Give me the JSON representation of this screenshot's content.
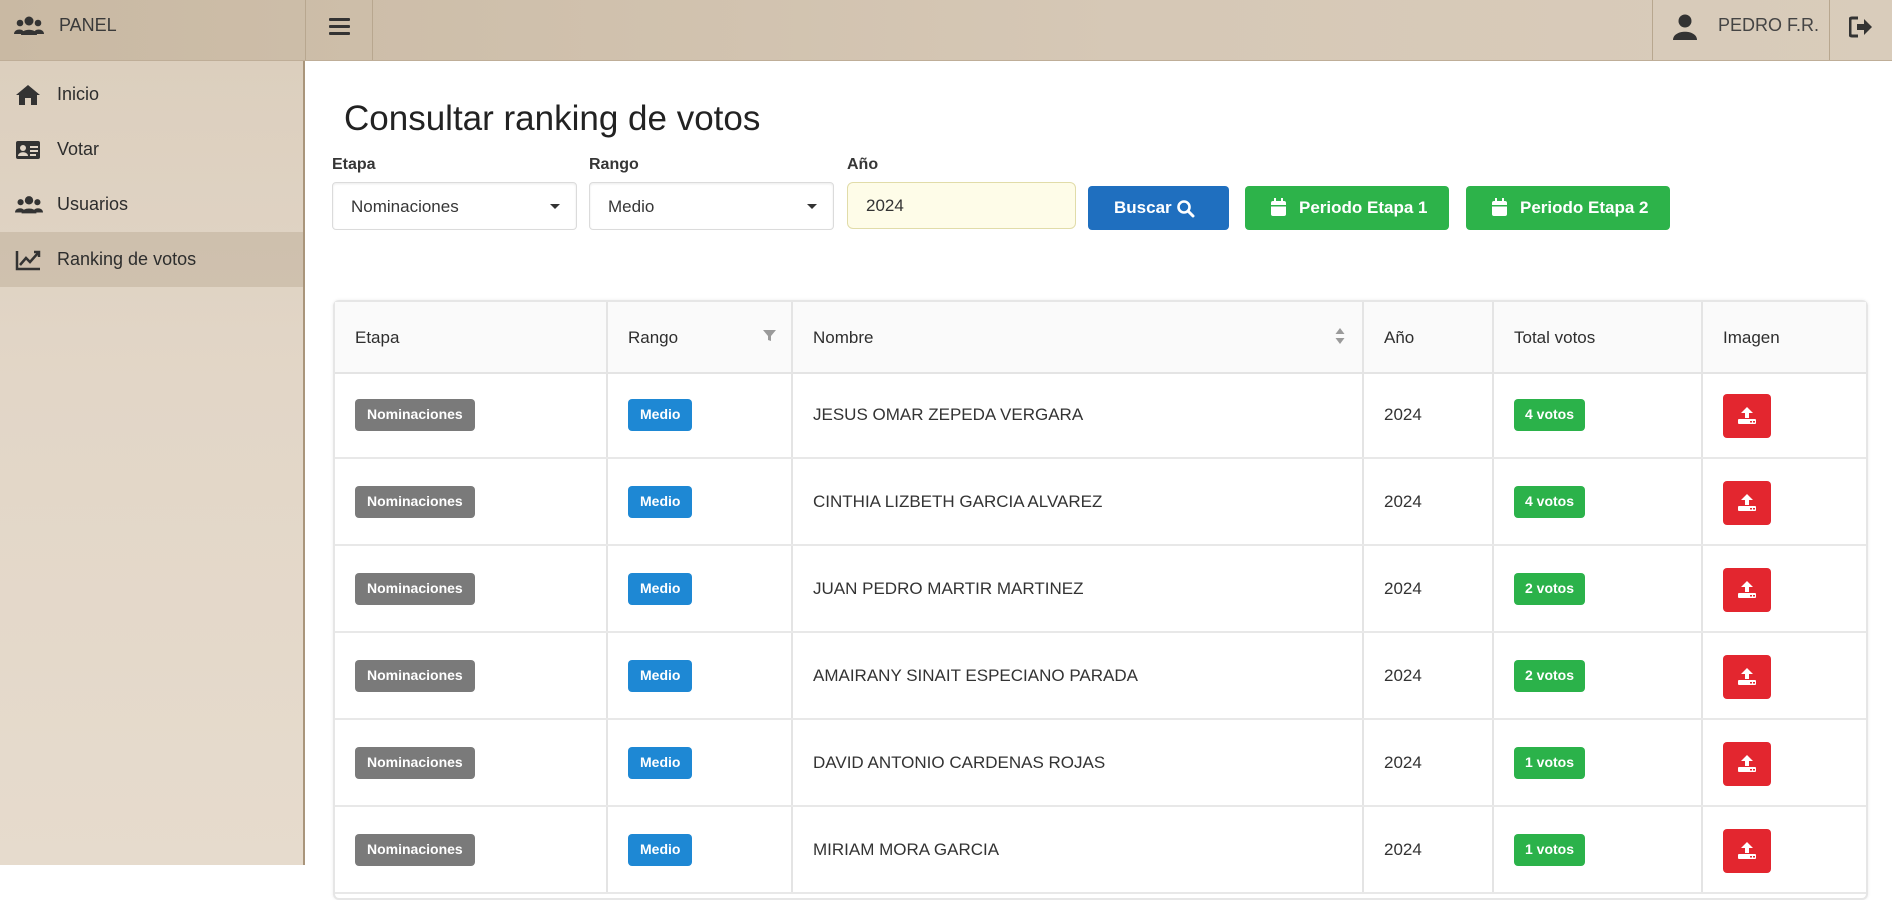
{
  "app": {
    "brand": "PANEL",
    "user": "PEDRO F.R."
  },
  "sidebar": {
    "items": [
      {
        "label": "Inicio",
        "icon": "home-icon"
      },
      {
        "label": "Votar",
        "icon": "id-card-icon"
      },
      {
        "label": "Usuarios",
        "icon": "users-icon"
      },
      {
        "label": "Ranking de votos",
        "icon": "chart-line-icon",
        "active": true
      }
    ]
  },
  "page": {
    "title": "Consultar ranking de votos"
  },
  "filters": {
    "etapa_label": "Etapa",
    "etapa_value": "Nominaciones",
    "rango_label": "Rango",
    "rango_value": "Medio",
    "anio_label": "Año",
    "anio_value": "2024"
  },
  "buttons": {
    "buscar": "Buscar",
    "periodo1": "Periodo Etapa 1",
    "periodo2": "Periodo Etapa 2"
  },
  "table": {
    "headers": [
      "Etapa",
      "Rango",
      "Nombre",
      "Año",
      "Total votos",
      "Imagen"
    ],
    "rows": [
      {
        "etapa": "Nominaciones",
        "rango": "Medio",
        "nombre": "JESUS OMAR ZEPEDA VERGARA",
        "anio": "2024",
        "votos": "4 votos"
      },
      {
        "etapa": "Nominaciones",
        "rango": "Medio",
        "nombre": "CINTHIA LIZBETH GARCIA ALVAREZ",
        "anio": "2024",
        "votos": "4 votos"
      },
      {
        "etapa": "Nominaciones",
        "rango": "Medio",
        "nombre": "JUAN PEDRO MARTIR MARTINEZ",
        "anio": "2024",
        "votos": "2 votos"
      },
      {
        "etapa": "Nominaciones",
        "rango": "Medio",
        "nombre": "AMAIRANY SINAIT ESPECIANO PARADA",
        "anio": "2024",
        "votos": "2 votos"
      },
      {
        "etapa": "Nominaciones",
        "rango": "Medio",
        "nombre": "DAVID ANTONIO CARDENAS ROJAS",
        "anio": "2024",
        "votos": "1 votos"
      },
      {
        "etapa": "Nominaciones",
        "rango": "Medio",
        "nombre": "MIRIAM MORA GARCIA",
        "anio": "2024",
        "votos": "1 votos"
      }
    ]
  },
  "colors": {
    "primary": "#1f6fbf",
    "success": "#2db34a",
    "danger": "#e3262f",
    "tag_grey": "#7a7a7a",
    "tag_blue": "#1e88d4",
    "sidebar": "#e2d6c7"
  }
}
